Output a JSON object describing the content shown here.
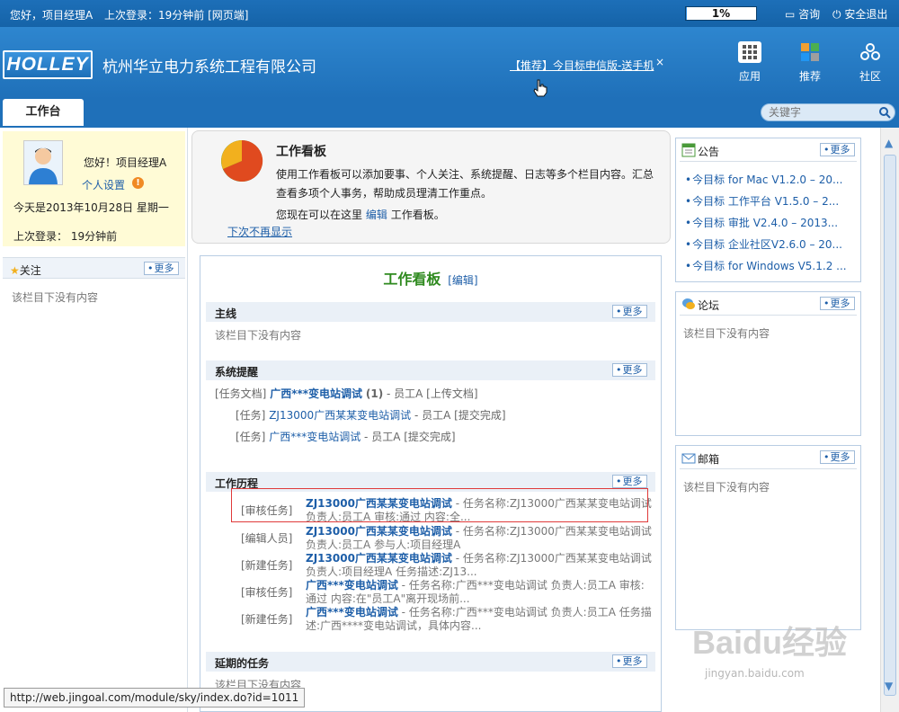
{
  "topbar": {
    "greeting": "您好，项目经理A",
    "last_login": "上次登录：19分钟前 [网页端]",
    "progress_text": "1%",
    "progress_value": 0.01,
    "consult": "咨询",
    "logout": "安全退出"
  },
  "header": {
    "logo": "HOLLEY",
    "company": "杭州华立电力系统工程有限公司",
    "promo": "【推荐】今目标申信版-送手机",
    "promo_close": "×",
    "icons": [
      {
        "label": "应用",
        "icon": "apps-grid-icon"
      },
      {
        "label": "推荐",
        "icon": "recommend-icon"
      },
      {
        "label": "社区",
        "icon": "community-icon"
      }
    ]
  },
  "tabs": {
    "workbench": "工作台"
  },
  "search": {
    "placeholder": "关键字"
  },
  "profile": {
    "hello": "您好！项目经理A",
    "settings": "个人设置",
    "today": "今天是2013年10月28日 星期一",
    "last_login": "上次登录：  19分钟前"
  },
  "follow": {
    "title": "关注",
    "more": "更多",
    "empty": "该栏目下没有内容"
  },
  "hint": {
    "title": "工作看板",
    "desc": "使用工作看板可以添加要事、个人关注、系统提醒、日志等多个栏目内容。汇总查看多项个人事务，帮助成员理清工作重点。",
    "edit_prefix": "您现在可以在这里",
    "edit_link": "编辑",
    "edit_suffix": "工作看板。",
    "dont_show": "下次不再显示"
  },
  "board": {
    "title": "工作看板",
    "edit": "[编辑]",
    "more": "更多",
    "sections": {
      "main": {
        "title": "主线",
        "empty": "该栏目下没有内容"
      },
      "reminders": {
        "title": "系统提醒",
        "items": [
          {
            "tag": "[任务文档]",
            "link": "广西***变电站调试",
            "count": "(1)",
            "extra": "- 员工A [上传文档]"
          },
          {
            "tag": "[任务]",
            "link": "ZJ13000广西某某变电站调试",
            "extra": "- 员工A [提交完成]"
          },
          {
            "tag": "[任务]",
            "link": "广西***变电站调试",
            "extra": "- 员工A [提交完成]"
          }
        ]
      },
      "history": {
        "title": "工作历程",
        "items": [
          {
            "tag": "[审核任务]",
            "link": "ZJ13000广西某某变电站调试",
            "text": " - 任务名称:ZJ13000广西某某变电站调试 负责人:员工A 审核:通过 内容:全..."
          },
          {
            "tag": "[编辑人员]",
            "link": "ZJ13000广西某某变电站调试",
            "text": " - 任务名称:ZJ13000广西某某变电站调试 负责人:员工A 参与人:项目经理A"
          },
          {
            "tag": "[新建任务]",
            "link": "ZJ13000广西某某变电站调试",
            "text": " - 任务名称:ZJ13000广西某某变电站调试 负责人:项目经理A 任务描述:ZJ13..."
          },
          {
            "tag": "[审核任务]",
            "link": "广西***变电站调试",
            "text": " - 任务名称:广西***变电站调试 负责人:员工A 审核:通过 内容:在\"员工A\"离开现场前..."
          },
          {
            "tag": "[新建任务]",
            "link": "广西***变电站调试",
            "text": " - 任务名称:广西***变电站调试 负责人:员工A 任务描述:广西****变电站调试，具体内容..."
          }
        ]
      },
      "overdue": {
        "title": "延期的任务",
        "empty": "该栏目下没有内容"
      }
    }
  },
  "notice": {
    "title": "公告",
    "more": "更多",
    "items": [
      "今目标 for Mac V1.2.0 – 20...",
      "今目标 工作平台 V1.5.0 – 2...",
      "今目标 审批 V2.4.0 – 2013...",
      "今目标 企业社区V2.6.0 – 20...",
      "今目标 for Windows V5.1.2 ..."
    ]
  },
  "forum": {
    "title": "论坛",
    "more": "更多",
    "empty": "该栏目下没有内容"
  },
  "mail": {
    "title": "邮箱",
    "more": "更多",
    "empty": "该栏目下没有内容"
  },
  "statusbar": {
    "url": "http://web.jingoal.com/module/sky/index.do?id=1011"
  },
  "watermark": {
    "logo": "Baidu经验",
    "url": "jingyan.baidu.com"
  }
}
